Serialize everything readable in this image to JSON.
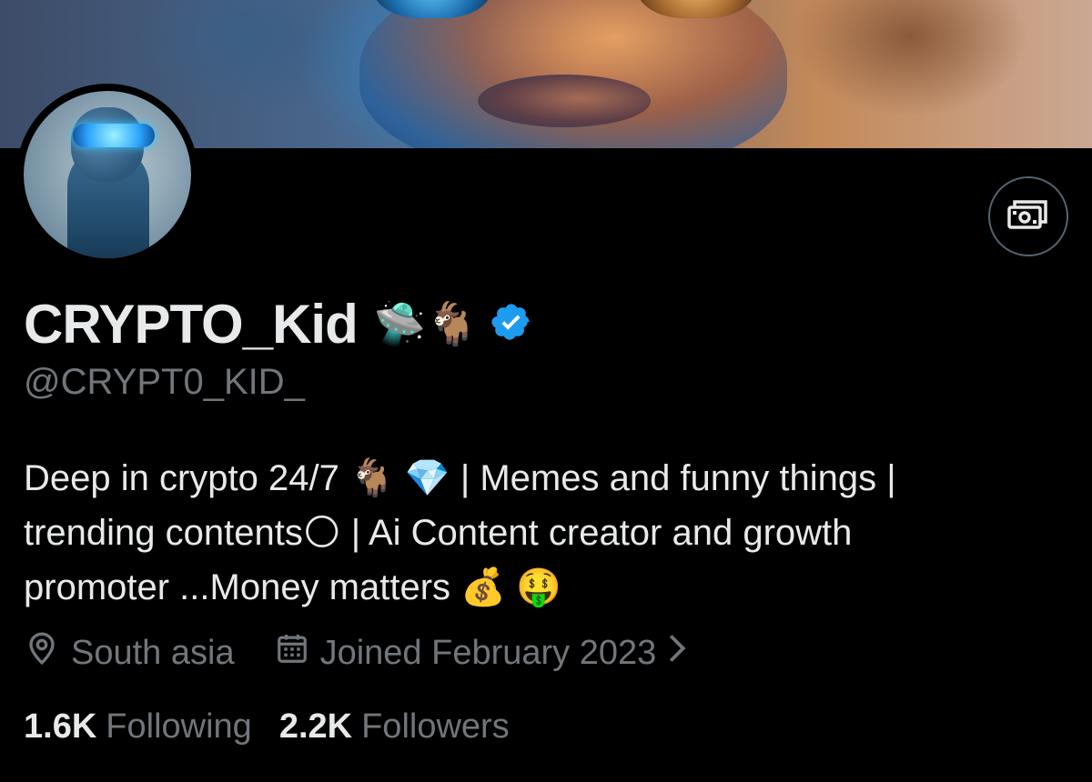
{
  "profile": {
    "display_name": "CRYPTO_Kid",
    "name_emojis": "🛸🐐",
    "handle": "@CRYPT0_KID_",
    "verified_color": "#1d9bf0",
    "bio_lines": [
      "Deep in crypto 24/7 🐐 💎 | Memes and funny things |",
      "trending contents🌕 | Ai Content creator and growth",
      "promoter ...Money matters 💰 🤑"
    ],
    "location": "South asia",
    "joined": "Joined February 2023",
    "following_count": "1.6K",
    "following_label": "Following",
    "followers_count": "2.2K",
    "followers_label": "Followers"
  },
  "icons": {
    "action_button": "subscription-money-icon",
    "location": "location-pin-icon",
    "joined": "calendar-icon",
    "chevron": "chevron-right-icon",
    "verified": "verified-badge-icon"
  }
}
